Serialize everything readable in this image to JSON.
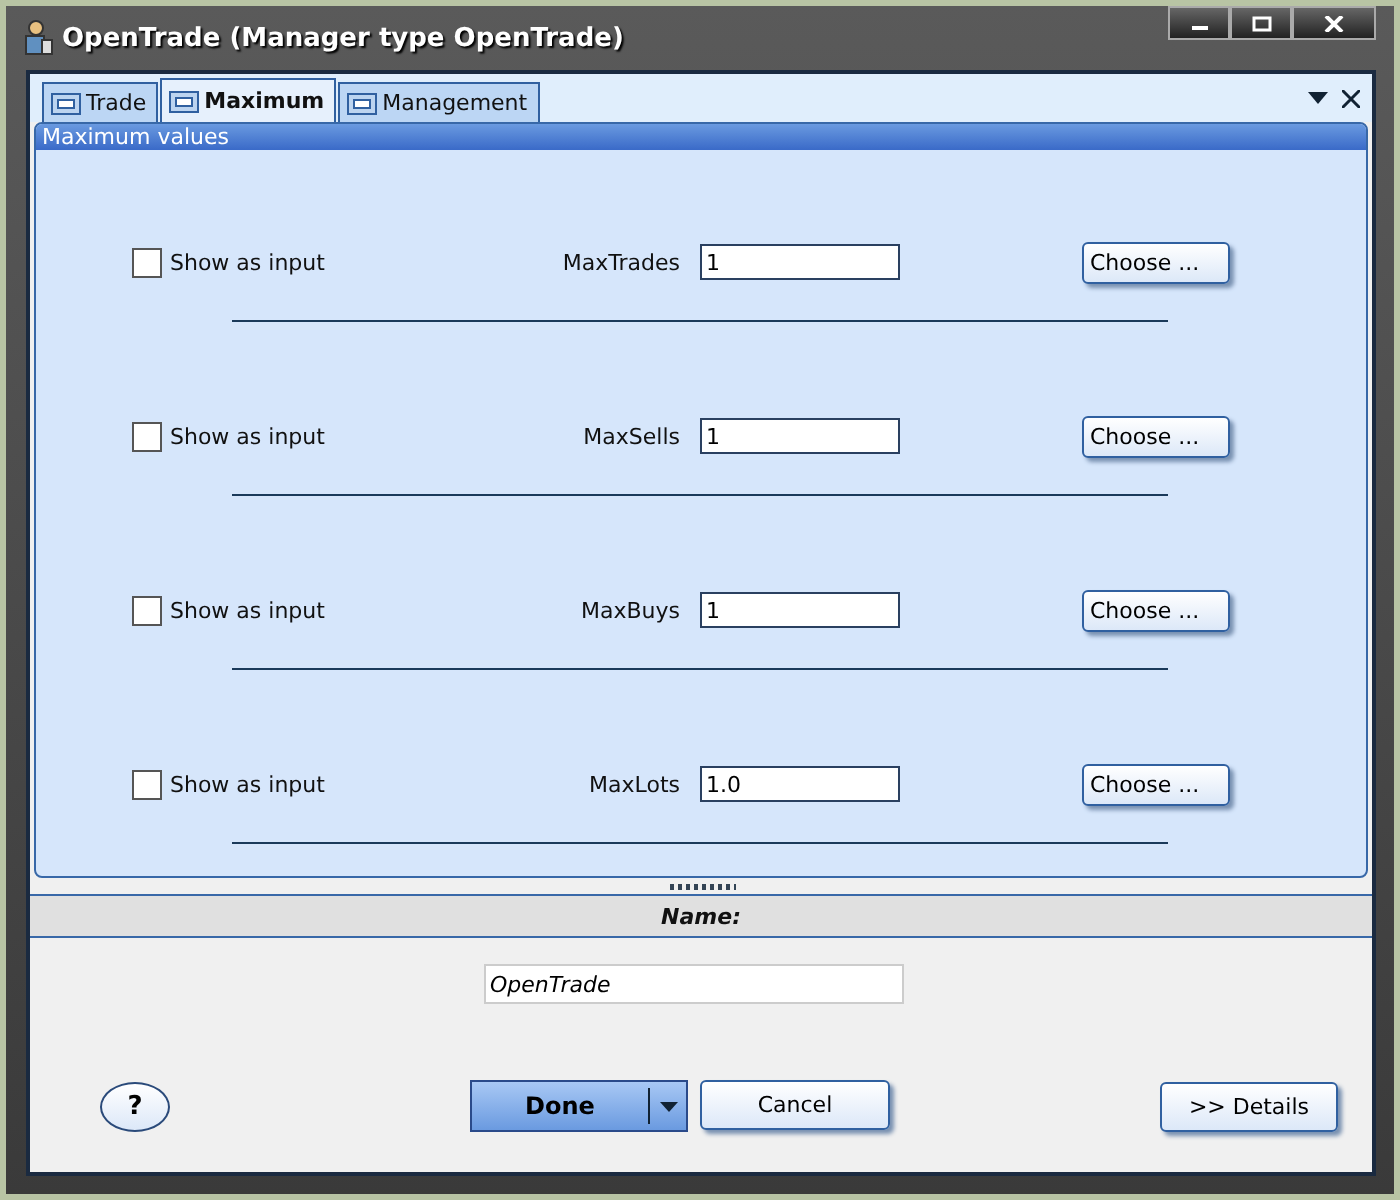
{
  "window": {
    "title": "OpenTrade (Manager type OpenTrade)"
  },
  "tabs": [
    {
      "label": "Trade",
      "selected": false
    },
    {
      "label": "Maximum",
      "selected": true
    },
    {
      "label": "Management",
      "selected": false
    }
  ],
  "panel": {
    "title": "Maximum values"
  },
  "rows": [
    {
      "checkbox_label": "Show as input",
      "checked": false,
      "name": "MaxTrades",
      "value": "1",
      "button": "Choose ..."
    },
    {
      "checkbox_label": "Show as input",
      "checked": false,
      "name": "MaxSells",
      "value": "1",
      "button": "Choose ..."
    },
    {
      "checkbox_label": "Show as input",
      "checked": false,
      "name": "MaxBuys",
      "value": "1",
      "button": "Choose ..."
    },
    {
      "checkbox_label": "Show as input",
      "checked": false,
      "name": "MaxLots",
      "value": "1.0",
      "button": "Choose ..."
    }
  ],
  "name_section": {
    "label": "Name:",
    "value": "OpenTrade"
  },
  "buttons": {
    "help": "?",
    "done": "Done",
    "cancel": "Cancel",
    "details": ">> Details"
  }
}
